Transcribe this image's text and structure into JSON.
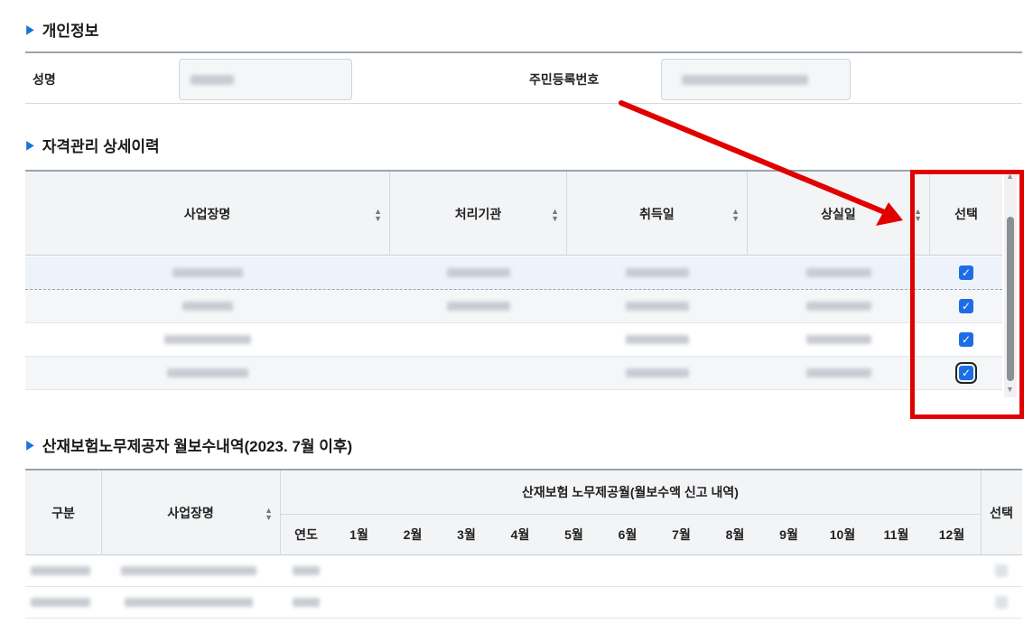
{
  "personal": {
    "title": "개인정보",
    "name_label": "성명",
    "rrn_label": "주민등록번호"
  },
  "qualification": {
    "title": "자격관리 상세이력",
    "columns": [
      "사업장명",
      "처리기관",
      "취득일",
      "상실일",
      "선택"
    ],
    "rows": [
      {
        "checked": true
      },
      {
        "checked": true
      },
      {
        "checked": true
      },
      {
        "checked": true
      }
    ]
  },
  "wage": {
    "title": "산재보험노무제공자 월보수내역(2023. 7월 이후)",
    "col_category": "구분",
    "col_workplace": "사업장명",
    "group_header": "산재보험 노무제공월(월보수액 신고 내역)",
    "col_year": "연도",
    "months": [
      "1월",
      "2월",
      "3월",
      "4월",
      "5월",
      "6월",
      "7월",
      "8월",
      "9월",
      "10월",
      "11월",
      "12월"
    ],
    "col_select": "선택"
  },
  "colors": {
    "accent": "#1a73d8",
    "checkbox": "#1d6ee6",
    "annotation": "#e10000"
  }
}
